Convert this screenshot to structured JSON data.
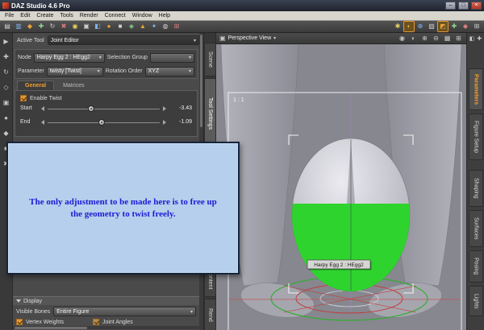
{
  "window": {
    "title": "DAZ Studio 4.6 Pro",
    "minimize": "–",
    "maximize": "□",
    "close": "×"
  },
  "icons": {
    "chevron_down": "▾"
  },
  "menu": {
    "items": [
      "File",
      "Edit",
      "Create",
      "Tools",
      "Render",
      "Connect",
      "Window",
      "Help"
    ]
  },
  "toolbar": {
    "main": [
      "▤",
      "▥",
      "◆",
      "✚",
      "↻",
      "✖",
      "◉",
      "▣",
      "◧",
      "●",
      "■",
      "◈",
      "▲",
      "✦",
      "◍",
      "⊞"
    ],
    "right": [
      "✱",
      "◐",
      "⊕",
      "▧",
      "◩",
      "✚",
      "◆",
      "⊞"
    ]
  },
  "left_strip": {
    "icons": [
      "▶",
      "✚",
      "↻",
      "◇",
      "▣",
      "●",
      "◆",
      "■",
      "✖"
    ]
  },
  "tool_panel": {
    "active_tool_label": "Active Tool",
    "active_tool_value": "Joint Editor",
    "node_label": "Node",
    "node_value": "Harpy Egg 2 : HEgg2",
    "selection_group_label": "Selection Group",
    "selection_group_value": "",
    "parameter_label": "Parameter",
    "parameter_value": "twisty [Twist]",
    "rotation_order_label": "Rotation Order",
    "rotation_order_value": "XYZ",
    "tab_general": "General",
    "tab_matrices": "Matrices",
    "enable_twist": {
      "label": "Enable Twist",
      "checked": true
    },
    "sliders": [
      {
        "label": "Start",
        "value": "-3.43"
      },
      {
        "label": "End",
        "value": "-1.09"
      }
    ],
    "display": {
      "title": "Display",
      "visible_bones_label": "Visible Bones",
      "visible_bones_value": "Entire Figure",
      "vertex_weights": {
        "label": "Vertex Weights",
        "checked": true
      },
      "joint_angles": {
        "label": "Joint Angles",
        "checked": true
      }
    }
  },
  "left_dock": {
    "tabs": [
      "Scene",
      "Tool Settings",
      "Content",
      "Rend"
    ]
  },
  "right_dock": {
    "icons": [
      "◧",
      "✚"
    ],
    "tabs": [
      "Parameters",
      "Figure Setup",
      "Shaping",
      "Surfaces",
      "Posing",
      "Lights"
    ]
  },
  "viewport": {
    "view_selector": "Perspective View",
    "aspect_label": "1 : 1",
    "selection_tooltip": "Harpy Egg 2 : HEgg2",
    "header_icons": [
      "◉",
      "◐",
      "⊕",
      "⊖",
      "▦",
      "⊞"
    ]
  },
  "callout": {
    "lines": [
      "The only adjustment to be made here is to free up",
      "the geometry to twist freely."
    ]
  },
  "colors": {
    "accent_orange": "#f0a030",
    "selection_green": "#2ed32e",
    "callout_bg": "#b5cfec",
    "callout_text": "#1b1bd6"
  }
}
